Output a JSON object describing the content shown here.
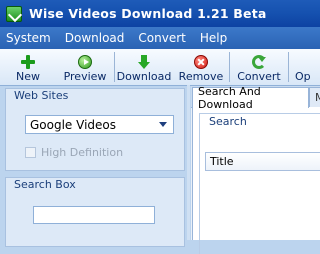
{
  "window": {
    "title": "Wise Videos Download 1.21 Beta"
  },
  "menu": [
    "System",
    "Download",
    "Convert",
    "Help"
  ],
  "toolbar": [
    {
      "label": "New",
      "icon": "plus-icon"
    },
    {
      "label": "Preview",
      "icon": "play-icon"
    },
    {
      "label": "Download",
      "icon": "down-arrow-icon"
    },
    {
      "label": "Remove",
      "icon": "remove-icon"
    },
    {
      "label": "Convert",
      "icon": "convert-icon"
    },
    {
      "label": "Op",
      "icon": "options-icon"
    }
  ],
  "web_sites": {
    "title": "Web Sites",
    "selected_site": "Google Videos",
    "high_definition_label": "High Definition"
  },
  "search_box": {
    "title": "Search Box",
    "value": ""
  },
  "tabs": [
    {
      "label": "Search And Download"
    },
    {
      "label": "M"
    }
  ],
  "search_group": {
    "title": "Search",
    "column_title": "Title"
  }
}
